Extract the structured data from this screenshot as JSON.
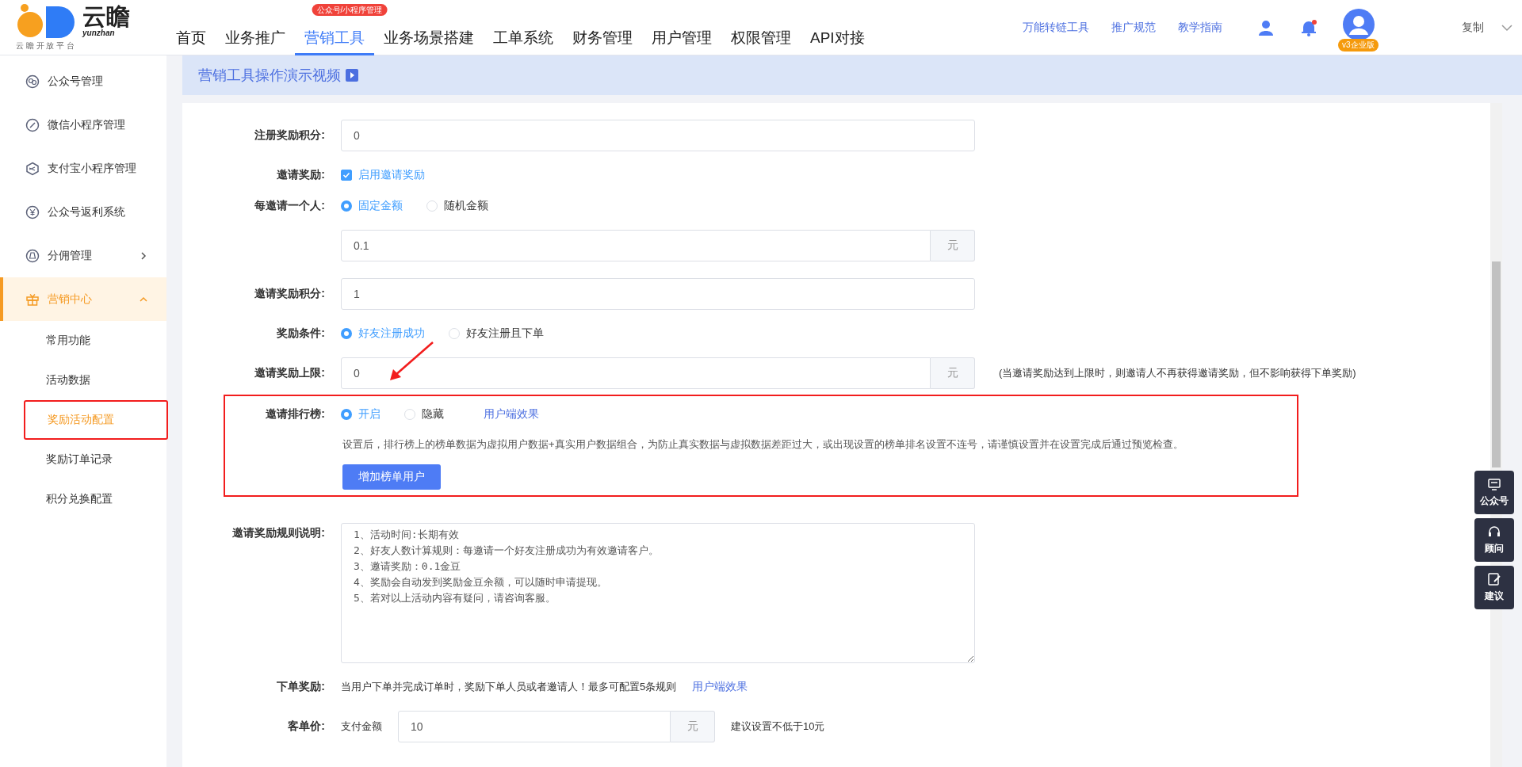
{
  "header": {
    "logo": {
      "name": "云瞻",
      "subtitle": "yunzhan",
      "tagline": "云 瞻 开 放 平 台"
    },
    "nav": [
      {
        "label": "首页",
        "selected": false
      },
      {
        "label": "业务推广",
        "selected": false
      },
      {
        "label": "营销工具",
        "selected": true,
        "badge": "公众号/小程序管理"
      },
      {
        "label": "业务场景搭建",
        "selected": false
      },
      {
        "label": "工单系统",
        "selected": false
      },
      {
        "label": "财务管理",
        "selected": false
      },
      {
        "label": "用户管理",
        "selected": false
      },
      {
        "label": "权限管理",
        "selected": false
      },
      {
        "label": "API对接",
        "selected": false
      }
    ],
    "links": [
      "万能转链工具",
      "推广规范",
      "教学指南"
    ],
    "notification_dot": true,
    "account": {
      "badge": "v3企业版",
      "action": "复制"
    }
  },
  "sidebar": {
    "items": [
      {
        "label": "公众号管理",
        "selected": false
      },
      {
        "label": "微信小程序管理",
        "selected": false
      },
      {
        "label": "支付宝小程序管理",
        "selected": false
      },
      {
        "label": "公众号返利系统",
        "selected": false
      },
      {
        "label": "分佣管理",
        "selected": false,
        "expanded": false
      },
      {
        "label": "营销中心",
        "selected": true,
        "expanded": true,
        "children": [
          {
            "label": "常用功能",
            "selected": false,
            "annotated": false
          },
          {
            "label": "活动数据",
            "selected": false,
            "annotated": false
          },
          {
            "label": "奖励活动配置",
            "selected": true,
            "annotated": true
          },
          {
            "label": "奖励订单记录",
            "selected": false,
            "annotated": false
          },
          {
            "label": "积分兑换配置",
            "selected": false,
            "annotated": false
          }
        ]
      }
    ]
  },
  "banner": {
    "title": "营销工具操作演示视频"
  },
  "form": {
    "rows": [
      {
        "kind": "input",
        "label": "注册奖励积分:",
        "value": "0"
      },
      {
        "kind": "checkbox",
        "label": "邀请奖励:",
        "text": "启用邀请奖励",
        "checked": true
      },
      {
        "kind": "radio",
        "label": "每邀请一个人:",
        "options": [
          {
            "label": "固定金额",
            "selected": true
          },
          {
            "label": "随机金额",
            "selected": false
          }
        ]
      },
      {
        "kind": "input",
        "value": "0.1",
        "suffix": "元"
      },
      {
        "kind": "input",
        "label": "邀请奖励积分:",
        "value": "1"
      },
      {
        "kind": "radio",
        "label": "奖励条件:",
        "options": [
          {
            "label": "好友注册成功",
            "selected": true
          },
          {
            "label": "好友注册且下单",
            "selected": false
          }
        ]
      },
      {
        "kind": "input",
        "label": "邀请奖励上限:",
        "value": "0",
        "suffix": "元",
        "hint": "(当邀请奖励达到上限时，则邀请人不再获得邀请奖励，但不影响获得下单奖励)"
      },
      {
        "kind": "leaderboard",
        "label": "邀请排行榜:",
        "annotated": true,
        "options": [
          {
            "label": "开启",
            "selected": true
          },
          {
            "label": "隐藏",
            "selected": false
          }
        ],
        "link": "用户端效果",
        "note": "设置后，排行榜上的榜单数据为虚拟用户数据+真实用户数据组合，为防止真实数据与虚拟数据差距过大，或出现设置的榜单排名设置不连号，请谨慎设置并在设置完成后通过预览检查。",
        "button": "增加榜单用户"
      },
      {
        "kind": "textarea",
        "label": "邀请奖励规则说明:",
        "lines": [
          "1、活动时间:长期有效",
          "2、好友人数计算规则：每邀请一个好友注册成功为有效邀请客户。",
          "3、邀请奖励：0.1金豆",
          "4、奖励会自动发到奖励金豆余额，可以随时申请提现。",
          "5、若对以上活动内容有疑问，请咨询客服。"
        ]
      },
      {
        "kind": "text",
        "label": "下单奖励:",
        "text": "当用户下单并完成订单时，奖励下单人员或者邀请人！最多可配置5条规则",
        "link": "用户端效果"
      },
      {
        "kind": "price",
        "label": "客单价:",
        "prefix": "支付金额",
        "value": "10",
        "suffix": "元",
        "hint": "建议设置不低于10元"
      }
    ]
  },
  "float_buttons": [
    "公众号",
    "顾问",
    "建议"
  ]
}
